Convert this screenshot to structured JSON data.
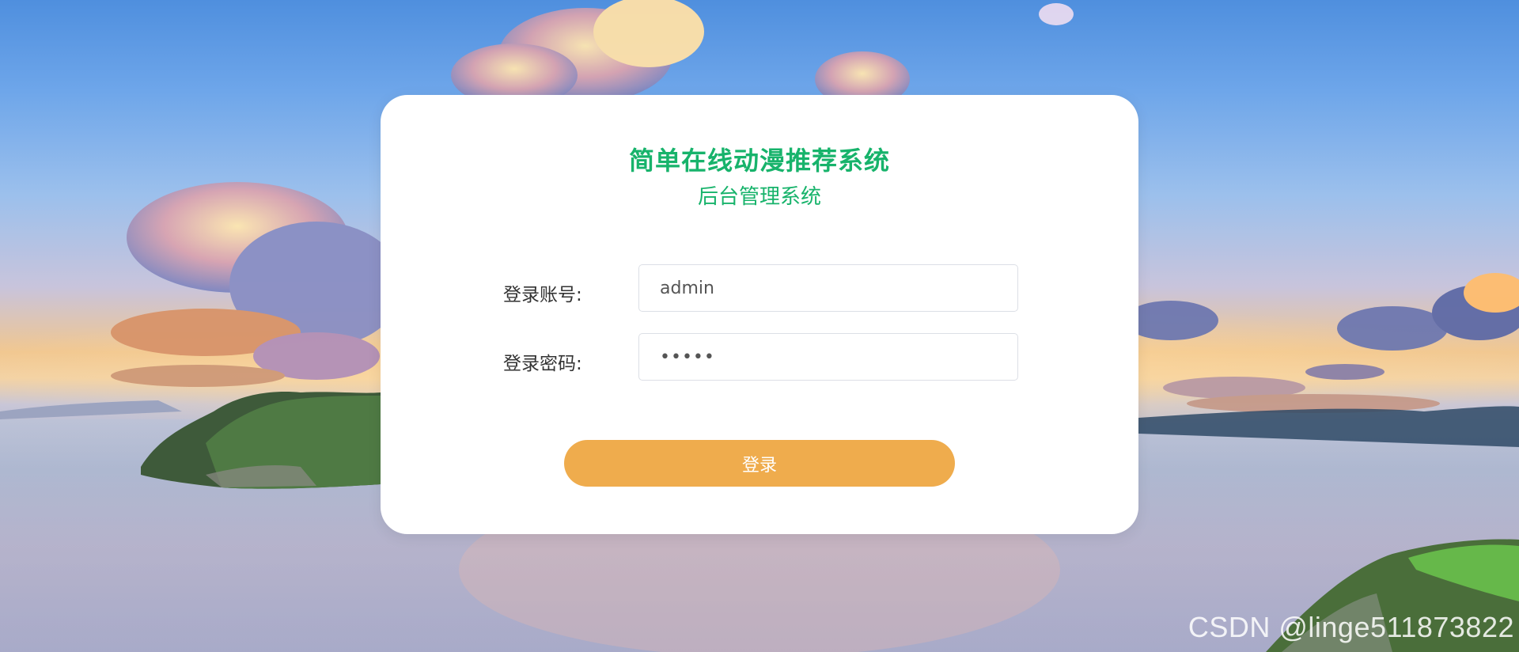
{
  "app": {
    "title": "简单在线动漫推荐系统",
    "subtitle": "后台管理系统"
  },
  "login_form": {
    "account_label": "登录账号:",
    "account_value": "admin",
    "password_label": "登录密码:",
    "password_value": "•••••",
    "submit_label": "登录"
  },
  "watermark": "CSDN @linge511873822",
  "colors": {
    "brand_green": "#17b36b",
    "button_orange": "#efac4d",
    "card_background": "#ffffff"
  }
}
